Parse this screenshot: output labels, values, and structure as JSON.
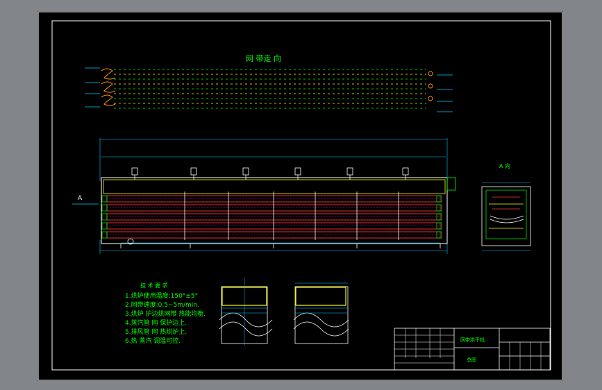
{
  "colors": {
    "background": "#828589",
    "paper": "#000000",
    "frame": "#ffffff",
    "mesh_green": "#00ff00",
    "mesh_yellow": "#ffff00",
    "belt_red": "#ff3333",
    "belt_magenta": "#ff00ff"
  },
  "icons": {
    "compass": "circle-target-icon"
  },
  "drawing": {
    "top_view_title": "网 带走 向",
    "section_marker": "A",
    "side_view_title": "A 向",
    "tech_title": "技 术 要 求",
    "tech_notes": [
      "1.烘炉使用温度:150°±5°",
      "2.网带速度:0.5~5m/min.",
      "3.烘炉   护边烘网带 热能均衡.",
      "4.蒸汽管  网   保护边上.",
      "5.排风管  网   热烘炉上.",
      "6.热 蒸汽    调温可控."
    ],
    "title_block": {
      "drawing_name": "网带烘干机",
      "sub_name": "总图"
    }
  }
}
